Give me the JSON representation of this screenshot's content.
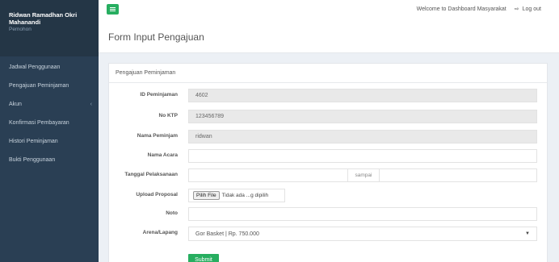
{
  "sidebar": {
    "user_name": "Ridwan Ramadhan Okri Mahanandi",
    "user_role": "Pemohon",
    "items": [
      {
        "label": "Jadwal Penggunaan"
      },
      {
        "label": "Pengajuan Peminjaman"
      },
      {
        "label": "Akun",
        "chevron": "‹"
      },
      {
        "label": "Konfirmasi Pembayaran"
      },
      {
        "label": "Histori Peminjaman"
      },
      {
        "label": "Bukti Penggunaan"
      }
    ]
  },
  "topbar": {
    "welcome": "Welcome to Dashboard Masyarakat",
    "logout_icon": "⇨",
    "logout_label": "Log out"
  },
  "page": {
    "title": "Form Input Pengajuan"
  },
  "panel": {
    "heading": "Pengajuan Peminjaman",
    "fields": {
      "id_label": "ID Peminjaman",
      "id_value": "4602",
      "ktp_label": "No KTP",
      "ktp_value": "123456789",
      "nama_label": "Nama Peminjam",
      "nama_value": "ridwan",
      "acara_label": "Nama Acara",
      "acara_value": "",
      "tanggal_label": "Tanggal Pelaksanaan",
      "tanggal_sep": "sampai",
      "proposal_label": "Upload Proposal",
      "file_button": "Pilih File",
      "file_status": "Tidak ada ...g dipilih",
      "noto_label": "Noto",
      "noto_value": "",
      "arena_label": "Arena/Lapang",
      "arena_value": "Gor Basket | Rp. 750.000",
      "submit_label": "Submit"
    }
  },
  "colors": {
    "accent": "#27ae60",
    "sidebar": "#2a3f54"
  }
}
